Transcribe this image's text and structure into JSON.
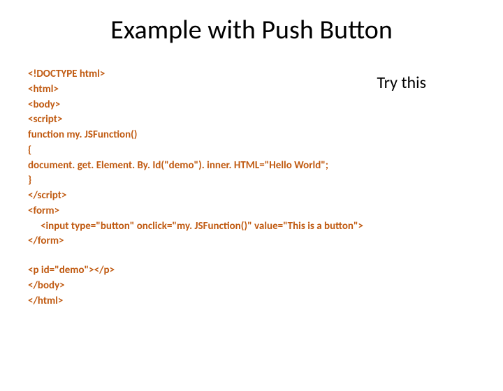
{
  "title": "Example with Push Button",
  "try_this": "Try this",
  "code": {
    "l1": "<!DOCTYPE html>",
    "l2": "<html>",
    "l3": "<body>",
    "l4": "<script>",
    "l5": "function my. JSFunction()",
    "l6": "{",
    "l7": "document. get. Element. By. Id(\"demo\"). inner. HTML=\"Hello World\";",
    "l8": "}",
    "l9": "</script>",
    "l10": "<form>",
    "l11": "<input type=\"button\" onclick=\"my. JSFunction()\" value=\"This is a button\">",
    "l12": "</form>",
    "l13": "<p id=\"demo\"></p>",
    "l14": "</body>",
    "l15": "</html>"
  }
}
